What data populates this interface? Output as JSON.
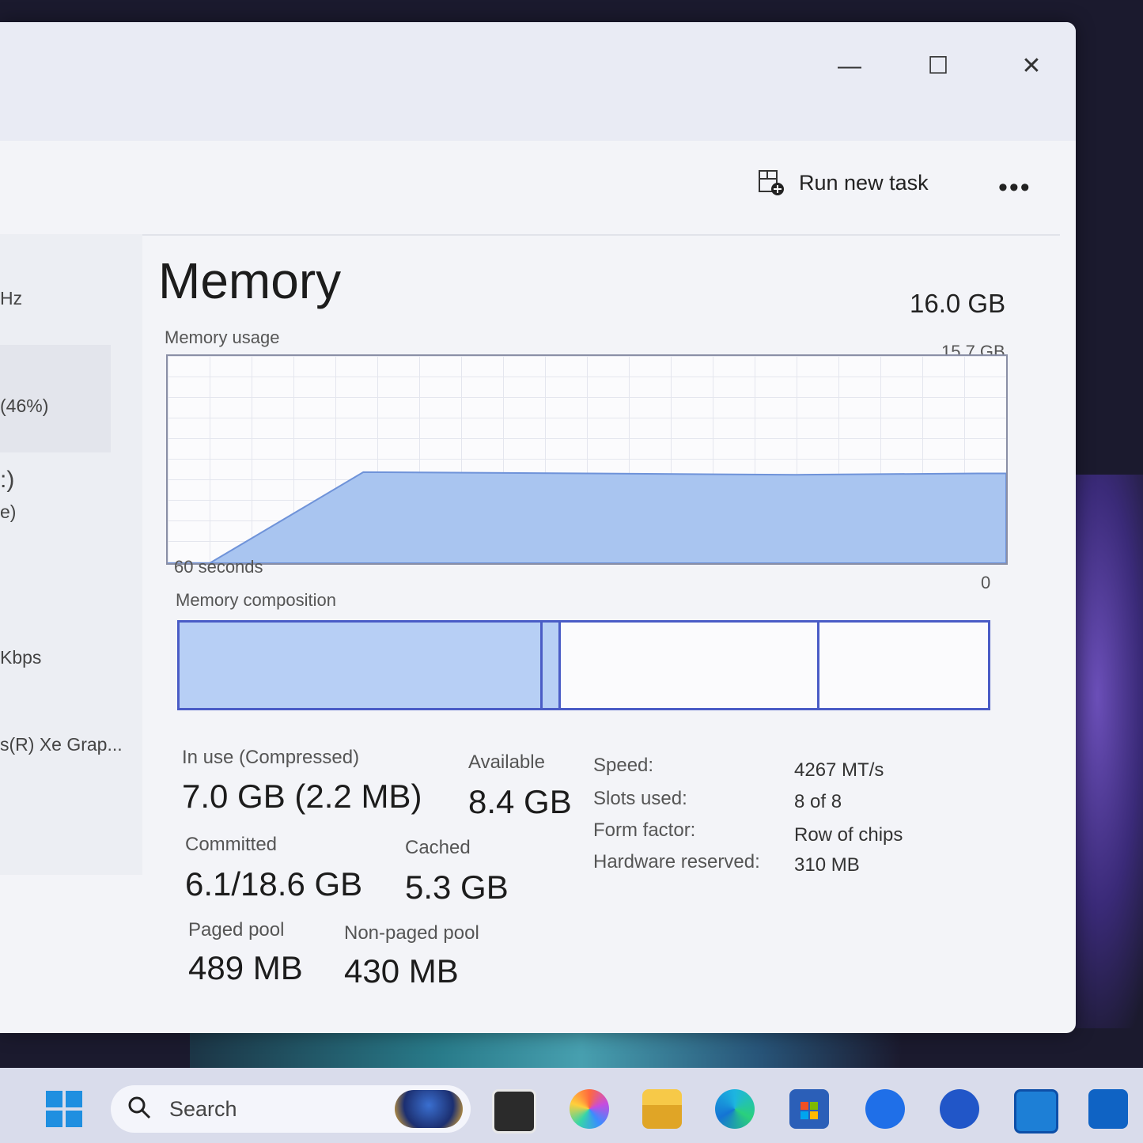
{
  "window": {
    "minimize_glyph": "—",
    "maximize_glyph": "☐",
    "close_glyph": "✕"
  },
  "toolbar": {
    "run_new_task_label": "Run new task",
    "more_label": "•••"
  },
  "sidebar": {
    "items": [
      "Hz",
      "(46%)",
      ":)",
      "e)",
      "Kbps",
      "s(R) Xe Grap..."
    ]
  },
  "memory": {
    "title": "Memory",
    "total": "16.0 GB",
    "usage_label": "Memory usage",
    "usage_max": "15.7 GB",
    "time_label": "60 seconds",
    "zero_label": "0",
    "composition_label": "Memory composition"
  },
  "chart_data": {
    "type": "area",
    "title": "Memory usage",
    "xlabel": "60 seconds",
    "ylim": [
      0,
      15.7
    ],
    "x": [
      60,
      57,
      46,
      30,
      15,
      2,
      0
    ],
    "values": [
      0,
      0,
      6.9,
      6.8,
      6.7,
      6.8,
      6.8
    ],
    "composition": {
      "in_use": 0.45,
      "modified": 0.02,
      "standby": 0.32,
      "free": 0.21
    }
  },
  "stats": {
    "in_use_label": "In use (Compressed)",
    "in_use_value": "7.0 GB (2.2 MB)",
    "available_label": "Available",
    "available_value": "8.4 GB",
    "committed_label": "Committed",
    "committed_value": "6.1/18.6 GB",
    "cached_label": "Cached",
    "cached_value": "5.3 GB",
    "paged_label": "Paged pool",
    "paged_value": "489 MB",
    "nonpaged_label": "Non-paged pool",
    "nonpaged_value": "430 MB"
  },
  "details": {
    "speed_label": "Speed:",
    "speed_value": "4267 MT/s",
    "slots_label": "Slots used:",
    "slots_value": "8 of 8",
    "form_label": "Form factor:",
    "form_value": "Row of chips",
    "hw_label": "Hardware reserved:",
    "hw_value": "310 MB"
  },
  "taskbar": {
    "search_placeholder": "Search"
  },
  "colors": {
    "accent": "#4a5cc6",
    "fill": "#a9c5f0"
  }
}
